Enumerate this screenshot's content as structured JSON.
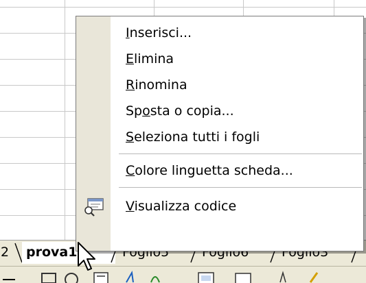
{
  "context_menu": {
    "items": [
      {
        "before": "",
        "mnemonic": "I",
        "after": "nserisci..."
      },
      {
        "before": "",
        "mnemonic": "E",
        "after": "limina"
      },
      {
        "before": "",
        "mnemonic": "R",
        "after": "inomina"
      },
      {
        "before": "Sp",
        "mnemonic": "o",
        "after": "sta o copia..."
      },
      {
        "before": "",
        "mnemonic": "S",
        "after": "eleziona tutti i fogli"
      },
      {
        "before": "",
        "mnemonic": "C",
        "after": "olore linguetta scheda..."
      },
      {
        "before": "",
        "mnemonic": "V",
        "after": "isualizza codice"
      }
    ],
    "code_icon": "view-code-icon"
  },
  "sheet_tabs": {
    "partial_left": "2",
    "active": "prova1",
    "others": [
      "Foglio5",
      "Foglio6",
      "Foglio3"
    ]
  },
  "colors": {
    "menu_gutter": "#e9e6d9",
    "tab_strip": "#ece9d8",
    "grid_line": "#c8c8c8"
  }
}
